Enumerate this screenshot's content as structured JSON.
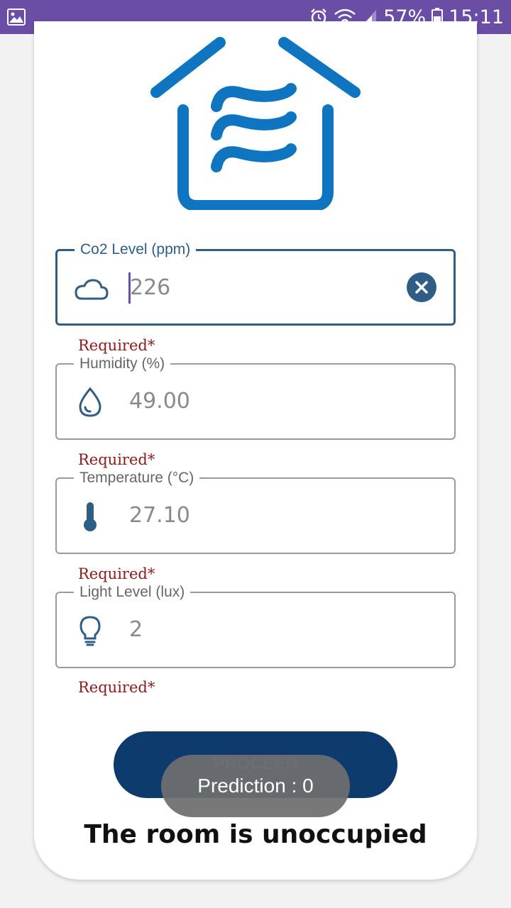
{
  "status_bar": {
    "battery_percent": "57%",
    "time": "15:11",
    "icons": [
      "gallery-icon",
      "alarm-icon",
      "wifi-icon",
      "signal-icon",
      "battery-icon"
    ]
  },
  "colors": {
    "status_bar": "#6a4ea6",
    "accent": "#2f5d86",
    "logo_blue": "#0f75c0",
    "button": "#0e3b6e",
    "required_text": "#8b1a1a"
  },
  "form": {
    "co2": {
      "label": "Co2 Level (ppm)",
      "value": "226",
      "icon": "cloud-icon",
      "required": "Required*"
    },
    "humidity": {
      "label": "Humidity (%)",
      "value": "49.00",
      "icon": "water-drop-icon",
      "required": "Required*"
    },
    "temperature": {
      "label": "Temperature (°C)",
      "value": "27.10",
      "icon": "thermometer-icon",
      "required": "Required*"
    },
    "light": {
      "label": "Light Level (lux)",
      "value": "2",
      "icon": "lightbulb-icon",
      "required": "Required*"
    }
  },
  "proceed_button": {
    "label": "PROCEED"
  },
  "toast": {
    "text": "Prediction : 0"
  },
  "result": {
    "text": "The room is unoccupied"
  }
}
